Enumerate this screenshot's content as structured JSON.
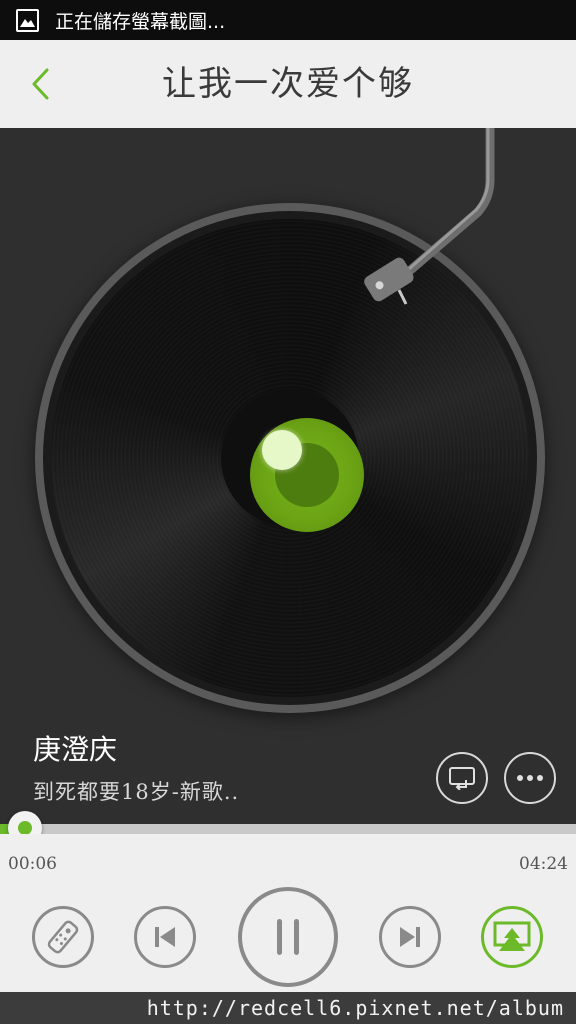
{
  "status_bar": {
    "text": "正在儲存螢幕截圖...",
    "icon": "screenshot-icon"
  },
  "header": {
    "title": "让我一次爱个够",
    "back_icon": "chevron-left-icon",
    "accent": "#6cba2a"
  },
  "now_playing": {
    "artist": "庚澄庆",
    "album": "到死都要18岁-新歌.."
  },
  "actions": {
    "cast_icon": "cast-icon",
    "more_icon": "more-icon"
  },
  "progress": {
    "elapsed": "00:06",
    "total": "04:24",
    "fraction": 0.023
  },
  "controls": {
    "remote_icon": "remote-icon",
    "prev_icon": "skip-previous-icon",
    "pause_icon": "pause-icon",
    "next_icon": "skip-next-icon",
    "airplay_icon": "airplay-icon"
  },
  "watermark": "http://redcell6.pixnet.net/album",
  "colors": {
    "accent": "#6cba2a",
    "record_label": "#6aa214"
  }
}
